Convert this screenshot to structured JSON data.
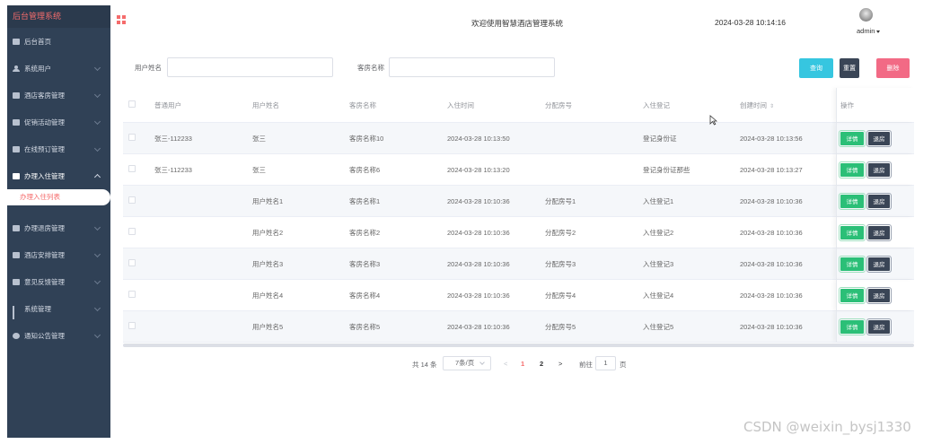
{
  "sidebar": {
    "title": "后台管理系统",
    "items": [
      {
        "label": "后台首页",
        "icon": "home-icon",
        "chevron": false
      },
      {
        "label": "系统用户",
        "icon": "user-icon",
        "chevron": true
      },
      {
        "label": "酒店客房管理",
        "icon": "grid-icon",
        "chevron": true
      },
      {
        "label": "促销活动管理",
        "icon": "grid-icon",
        "chevron": true
      },
      {
        "label": "在线预订管理",
        "icon": "grid-icon",
        "chevron": true
      },
      {
        "label": "办理入住管理",
        "icon": "grid-icon",
        "chevron": true,
        "open": true
      }
    ],
    "sub_item": "办理入住列表",
    "items_after": [
      {
        "label": "办理退房管理",
        "icon": "grid-icon"
      },
      {
        "label": "酒店安排管理",
        "icon": "grid-icon"
      },
      {
        "label": "意见反馈管理",
        "icon": "grid-icon"
      },
      {
        "label": "系统管理",
        "icon": "bar-chart-icon"
      },
      {
        "label": "通知公告管理",
        "icon": "info-icon"
      }
    ]
  },
  "header": {
    "title": "欢迎使用智慧酒店管理系统",
    "datetime": "2024-03-28 10:14:16",
    "user": "admin"
  },
  "search": {
    "username_label": "用户姓名",
    "username_value": "",
    "room_label": "客房名称",
    "room_value": "",
    "search_btn": "查询",
    "reset_btn": "重置",
    "delete_btn": "删除"
  },
  "table": {
    "columns": [
      "普通用户",
      "用户姓名",
      "客房名称",
      "入住时间",
      "分配房号",
      "入住登记",
      "创建时间",
      "操作"
    ],
    "rows": [
      [
        "张三-112233",
        "张三",
        "客房名称10",
        "2024-03-28 10:13:50",
        "",
        "登记身份证",
        "2024-03-28 10:13:56"
      ],
      [
        "张三-112233",
        "张三",
        "客房名称6",
        "2024-03-28 10:13:20",
        "",
        "登记身份证那些",
        "2024-03-28 10:13:27"
      ],
      [
        "",
        "用户姓名1",
        "客房名称1",
        "2024-03-28 10:10:36",
        "分配房号1",
        "入住登记1",
        "2024-03-28 10:10:36"
      ],
      [
        "",
        "用户姓名2",
        "客房名称2",
        "2024-03-28 10:10:36",
        "分配房号2",
        "入住登记2",
        "2024-03-28 10:10:36"
      ],
      [
        "",
        "用户姓名3",
        "客房名称3",
        "2024-03-28 10:10:36",
        "分配房号3",
        "入住登记3",
        "2024-03-28 10:10:36"
      ],
      [
        "",
        "用户姓名4",
        "客房名称4",
        "2024-03-28 10:10:36",
        "分配房号4",
        "入住登记4",
        "2024-03-28 10:10:36"
      ],
      [
        "",
        "用户姓名5",
        "客房名称5",
        "2024-03-28 10:10:36",
        "分配房号5",
        "入住登记5",
        "2024-03-28 10:10:36"
      ]
    ],
    "detail_btn": "详情",
    "checkout_btn": "退房"
  },
  "pagination": {
    "total": "共 14 条",
    "page_size": "7条/页",
    "prev": "<",
    "pages": [
      "1",
      "2"
    ],
    "current": "1",
    "next": ">",
    "goto_label": "前往",
    "goto_value": "1",
    "page_suffix": "页"
  },
  "watermark": "CSDN @weixin_bysj1330",
  "colors": {
    "sidebar_bg": "#304156",
    "accent": "#f56c6c",
    "search_btn": "#36c6e0",
    "reset_btn": "#3a4556",
    "delete_btn": "#f26a85",
    "detail_btn": "#2bbf77"
  }
}
